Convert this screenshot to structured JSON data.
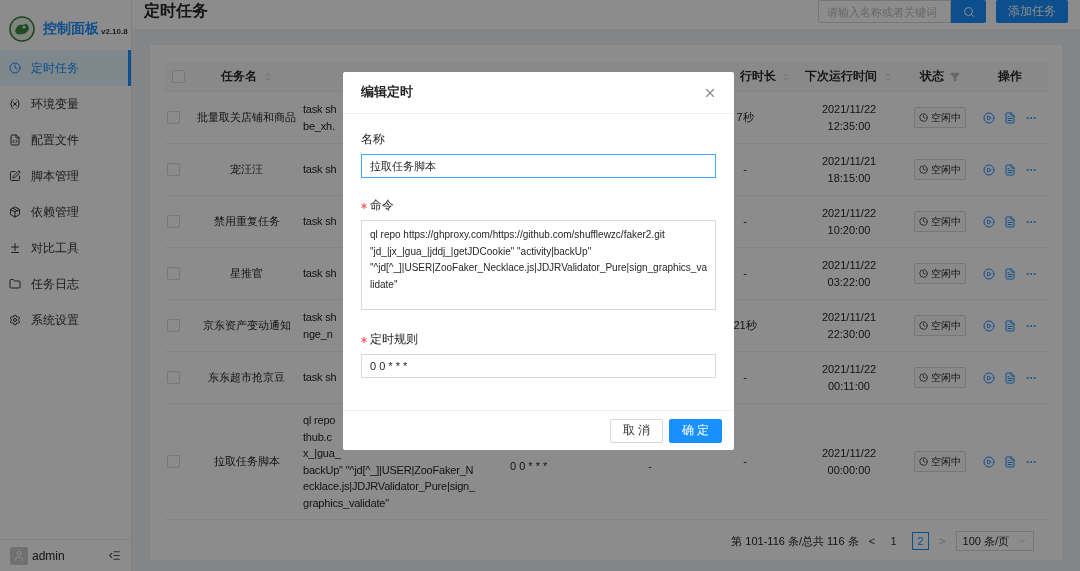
{
  "sidebar": {
    "title": "控制面板",
    "version": "v2.10.8",
    "items": [
      {
        "label": "定时任务",
        "selected": true
      },
      {
        "label": "环境变量",
        "selected": false
      },
      {
        "label": "配置文件",
        "selected": false
      },
      {
        "label": "脚本管理",
        "selected": false
      },
      {
        "label": "依赖管理",
        "selected": false
      },
      {
        "label": "对比工具",
        "selected": false
      },
      {
        "label": "任务日志",
        "selected": false
      },
      {
        "label": "系统设置",
        "selected": false
      }
    ],
    "user": "admin"
  },
  "header": {
    "title": "定时任务",
    "search": {
      "placeholder": "请输入名称或者关键词"
    },
    "add_button": "添加任务"
  },
  "table": {
    "select_all": {
      "checked": false
    },
    "columns": [
      {
        "label": "任务名",
        "kind": "sort"
      },
      {
        "label": "行时长",
        "kind": "sort"
      },
      {
        "label": "下次运行时间",
        "kind": "sort"
      },
      {
        "label": "状态",
        "kind": "filter"
      },
      {
        "label": "操作",
        "kind": "plain"
      }
    ],
    "rows": [
      {
        "checked": false,
        "name": "批量取关店铺和商品",
        "command": [
          "task sh",
          "be_xh."
        ],
        "duration": "7秒",
        "next_date": "2021/11/22",
        "next_time": "12:35:00",
        "status": "空闲中"
      },
      {
        "checked": false,
        "name": "宠汪汪",
        "command": [
          "task sh"
        ],
        "duration": "-",
        "next_date": "2021/11/21",
        "next_time": "18:15:00",
        "status": "空闲中"
      },
      {
        "checked": false,
        "name": "禁用重复任务",
        "command": [
          "task sh"
        ],
        "duration": "-",
        "next_date": "2021/11/22",
        "next_time": "10:20:00",
        "status": "空闲中"
      },
      {
        "checked": false,
        "name": "星推官",
        "command": [
          "task sh"
        ],
        "duration": "-",
        "next_date": "2021/11/22",
        "next_time": "03:22:00",
        "status": "空闲中"
      },
      {
        "checked": false,
        "name": "京东资产变动通知",
        "command": [
          "task sh",
          "nge_n"
        ],
        "duration": "21秒",
        "next_date": "2021/11/21",
        "next_time": "22:30:00",
        "status": "空闲中"
      },
      {
        "checked": false,
        "name": "东东超市抢京豆",
        "command": [
          "task sh"
        ],
        "duration": "-",
        "next_date": "2021/11/22",
        "next_time": "00:11:00",
        "status": "空闲中"
      },
      {
        "checked": false,
        "name": "拉取任务脚本",
        "command": [
          "ql repo",
          "thub.c",
          "x_|gua_",
          "backUp\" \"^jd[^_]|USER|ZooFaker_N",
          "ecklace.js|JDJRValidator_Pure|sign_",
          "graphics_validate\""
        ],
        "schedule": "0 0 * * *",
        "last_run": "-",
        "duration": "-",
        "next_date": "2021/11/22",
        "next_time": "00:00:00",
        "status": "空闲中"
      }
    ]
  },
  "pagination": {
    "summary": "第 101-116 条/总共 116 条",
    "prev": "<",
    "pages": [
      {
        "label": "1",
        "selected": false
      },
      {
        "label": "2",
        "selected": true
      }
    ],
    "next": ">",
    "page_size": "100 条/页"
  },
  "dialog": {
    "title": "编辑定时",
    "fields": [
      {
        "label": "名称",
        "required": false,
        "kind": "input",
        "value": "拉取任务脚本",
        "focused": true
      },
      {
        "label": "命令",
        "required": true,
        "kind": "textarea",
        "value": "ql repo https://ghproxy.com/https://github.com/shufflewzc/faker2.git \"jd_|jx_|gua_|jddj_|getJDCookie\" \"activity|backUp\" \"^jd[^_]|USER|ZooFaker_Necklace.js|JDJRValidator_Pure|sign_graphics_validate\"",
        "focused": false
      },
      {
        "label": "定时规则",
        "required": true,
        "kind": "input",
        "value": "0 0 * * *",
        "focused": false
      }
    ],
    "cancel": "取 消",
    "ok": "确 定"
  }
}
